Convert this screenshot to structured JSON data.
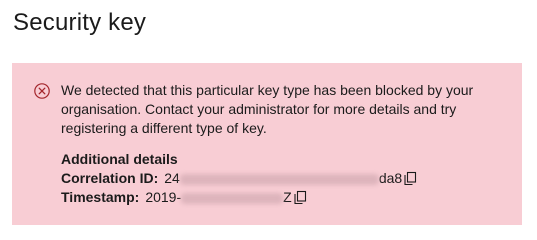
{
  "page": {
    "title": "Security key"
  },
  "error": {
    "message": "We detected that this particular key type has been blocked by your organisation. Contact your administrator for more details and try registering a different type of key.",
    "colors": {
      "panel_background": "#f8cdd4",
      "icon": "#a4262c"
    }
  },
  "details": {
    "heading": "Additional details",
    "correlation_label": "Correlation ID:",
    "correlation_prefix": "24",
    "correlation_suffix": "da8",
    "timestamp_label": "Timestamp:",
    "timestamp_prefix": "2019-",
    "timestamp_suffix": "Z",
    "copy_icon": "copy-icon"
  }
}
